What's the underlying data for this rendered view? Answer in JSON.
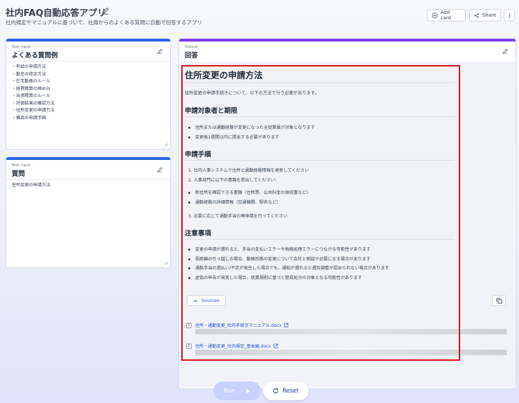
{
  "app": {
    "title": "社内FAQ自動応答アプリ",
    "subtitle": "社内規定やマニュアルに基づいて、社員からのよくある質問に自動で回答するアプリ"
  },
  "header_buttons": {
    "add_card": "Add card",
    "share": "Share"
  },
  "faq_card": {
    "caption": "Text input",
    "title": "よくある質問例",
    "items": [
      "・有給の申請方法",
      "・勤怠の修正方法",
      "・在宅勤務のルール",
      "・経費精算の締め日",
      "・出張精算のルール",
      "・評価結果の確認方法",
      "・住所変更の申請方法",
      "・備品の申請手順"
    ]
  },
  "question_card": {
    "caption": "Text input",
    "title": "質問",
    "value": "住所変更の申請方法"
  },
  "output_card": {
    "caption": "Output",
    "title": "回答",
    "heading": "住所変更の申請方法",
    "intro": "住所変更の申請手続きについて、以下の方法で行う必要があります。",
    "section1_title": "申請対象者と期限",
    "section1_items": [
      "住所または通勤経路が変更になった全従業員が対象となります",
      "変更後1週間以内に提出する必要があります"
    ],
    "section2_title": "申請手順",
    "section2_steps": [
      "1. 社内人事システムで住所と通勤経路情報を更新してください",
      "2. 人事部門に以下の書類を提出してください："
    ],
    "section2_docs": [
      "新住所を確認できる書類（住民票、公共料金の領収書など）",
      "通勤経路の詳細情報（交通機関、駅名など）"
    ],
    "section2_step3": "3. 必要に応じて通勤手当の再申請を行ってください",
    "section3_title": "注意事項",
    "section3_items": [
      "変更の申請が遅れると、手当の支払いエラーや税務処理エラーにつながる可能性があります",
      "長距離の引っ越しの場合、勤務形態の変更について会社と相談が必要になる場合があります",
      "通勤手当の過払い/不足が発生した場合でも、通知が遅れると遡及調整が認められない場合があります",
      "虚偽の申告が発覚した場合、就業規則に基づく懲戒処分の対象となる可能性があります"
    ],
    "sources_label": "Sources",
    "sources": [
      {
        "num": "1",
        "name": "住所・通勤変更_社内手続きマニュアル.docx"
      },
      {
        "num": "2",
        "name": "住所・通勤変更_社内規定_基本編.docx"
      }
    ]
  },
  "actions": {
    "run": "Run",
    "reset": "Reset"
  },
  "colors": {
    "input_accent": "#2563eb",
    "output_accent": "#7c3aed",
    "highlight_border": "#d9111b"
  }
}
